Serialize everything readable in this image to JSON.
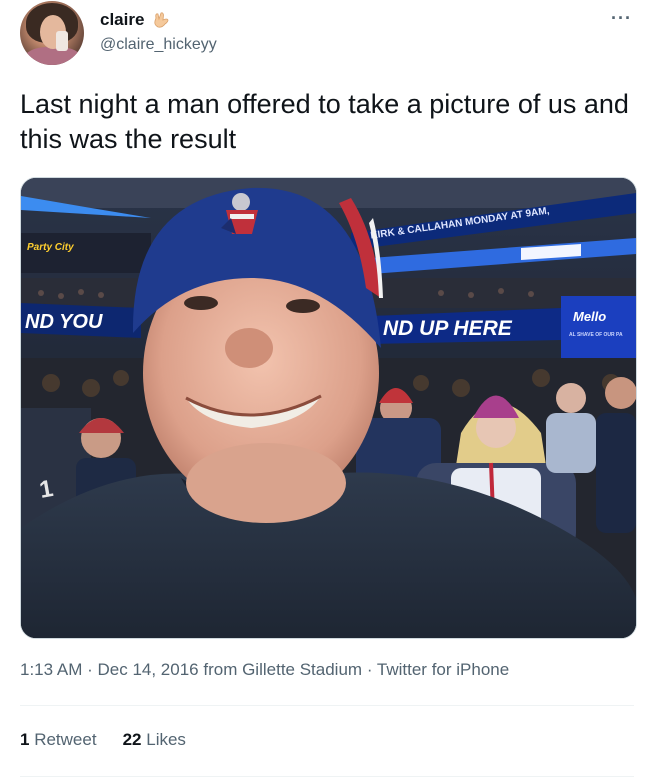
{
  "author": {
    "display_name": "claire",
    "handle": "@claire_hickeyy",
    "emoji_icon": "call-me-hand-icon",
    "avatar_icon": "profile-avatar"
  },
  "more_icon": "more-options-icon",
  "tweet": {
    "text": "Last night a man offered to take a picture of us and this was the result"
  },
  "photo": {
    "scoreboard_ribbon": "N KIRK & CALLAHAN MONDAY AT 9AM,",
    "party_city_sign": "Party City",
    "left_banner": "ND YOU",
    "right_banner": "ND UP HERE",
    "partner_logo": "Mello",
    "partner_tagline": "AL SHAVE OF OUR PA"
  },
  "meta": {
    "time": "1:13 AM",
    "separator": " · ",
    "date": "Dec 14, 2016",
    "location_text": "from Gillette Stadium",
    "source": "Twitter for iPhone"
  },
  "stats": {
    "retweets_count": "1",
    "retweets_label": "Retweet",
    "likes_count": "22",
    "likes_label": "Likes"
  },
  "colors": {
    "text_primary": "#0f1419",
    "text_secondary": "#536471",
    "divider": "#eff3f4",
    "beanie_blue": "#1f3b8e"
  }
}
